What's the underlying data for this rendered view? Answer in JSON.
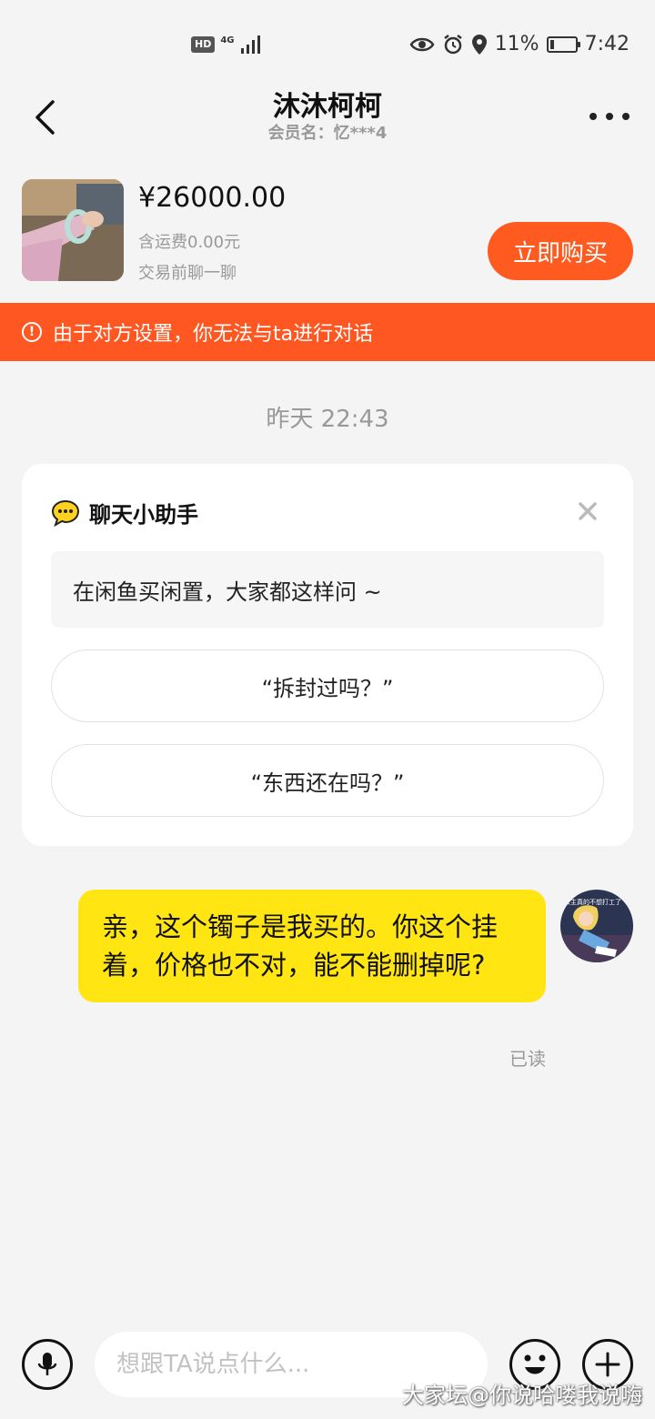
{
  "status_bar": {
    "hd": "HD",
    "network": "4G",
    "battery": "11%",
    "time": "7:42"
  },
  "header": {
    "title": "沐沐柯柯",
    "member_label": "会员名：忆***4"
  },
  "product": {
    "price": "¥26000.00",
    "shipping": "含运费0.00元",
    "hint": "交易前聊一聊",
    "buy_label": "立即购买"
  },
  "banner": {
    "text": "由于对方设置，你无法与ta进行对话"
  },
  "chat": {
    "timestamp": "昨天 22:43",
    "assistant": {
      "title": "聊天小助手",
      "prompt": "在闲鱼买闲置，大家都这样问 ~",
      "suggestions": [
        "“拆封过吗？”",
        "“东西还在吗？”"
      ]
    },
    "messages": [
      {
        "text": "亲，这个镯子是我买的。你这个挂着，价格也不对，能不能删掉呢?",
        "status": "已读",
        "avatar_caption": "公主真的不想打工了"
      }
    ]
  },
  "input": {
    "placeholder": "想跟TA说点什么..."
  },
  "watermark": "大家坛@你说哈喽我说嗨",
  "colors": {
    "accent": "#ff5722",
    "buy_button": "#ff5a1f",
    "bubble": "#ffe511",
    "background": "#f4f4f4"
  }
}
